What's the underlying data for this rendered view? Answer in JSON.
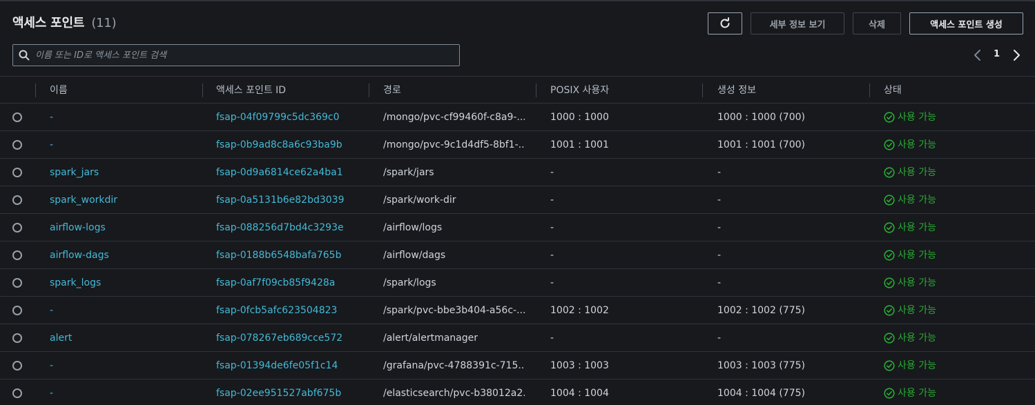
{
  "header": {
    "title": "액세스 포인트",
    "count": "(11)"
  },
  "toolbar": {
    "details_label": "세부 정보 보기",
    "delete_label": "삭제",
    "create_label": "액세스 포인트 생성"
  },
  "search": {
    "placeholder": "이름 또는 ID로 액세스 포인트 검색"
  },
  "pagination": {
    "current_page": "1"
  },
  "table": {
    "columns": [
      "이름",
      "액세스 포인트 ID",
      "경로",
      "POSIX 사용자",
      "생성 정보",
      "상태"
    ],
    "rows": [
      {
        "name": "-",
        "id": "fsap-04f09799c5dc369c0",
        "path": "/mongo/pvc-cf99460f-c8a9-...",
        "posix": "1000 : 1000",
        "create": "1000 : 1000 (700)",
        "status": "사용 가능"
      },
      {
        "name": "-",
        "id": "fsap-0b9ad8c8a6c93ba9b",
        "path": "/mongo/pvc-9c1d4df5-8bf1-...",
        "posix": "1001 : 1001",
        "create": "1001 : 1001 (700)",
        "status": "사용 가능"
      },
      {
        "name": "spark_jars",
        "id": "fsap-0d9a6814ce62a4ba1",
        "path": "/spark/jars",
        "posix": "-",
        "create": "-",
        "status": "사용 가능"
      },
      {
        "name": "spark_workdir",
        "id": "fsap-0a5131b6e82bd3039",
        "path": "/spark/work-dir",
        "posix": "-",
        "create": "-",
        "status": "사용 가능"
      },
      {
        "name": "airflow-logs",
        "id": "fsap-088256d7bd4c3293e",
        "path": "/airflow/logs",
        "posix": "-",
        "create": "-",
        "status": "사용 가능"
      },
      {
        "name": "airflow-dags",
        "id": "fsap-0188b6548bafa765b",
        "path": "/airflow/dags",
        "posix": "-",
        "create": "-",
        "status": "사용 가능"
      },
      {
        "name": "spark_logs",
        "id": "fsap-0af7f09cb85f9428a",
        "path": "/spark/logs",
        "posix": "-",
        "create": "-",
        "status": "사용 가능"
      },
      {
        "name": "-",
        "id": "fsap-0fcb5afc623504823",
        "path": "/spark/pvc-bbe3b404-a56c-...",
        "posix": "1002 : 1002",
        "create": "1002 : 1002 (775)",
        "status": "사용 가능"
      },
      {
        "name": "alert",
        "id": "fsap-078267eb689cce572",
        "path": "/alert/alertmanager",
        "posix": "-",
        "create": "-",
        "status": "사용 가능"
      },
      {
        "name": "-",
        "id": "fsap-01394de6fe05f1c14",
        "path": "/grafana/pvc-4788391c-715...",
        "posix": "1003 : 1003",
        "create": "1003 : 1003 (775)",
        "status": "사용 가능"
      },
      {
        "name": "-",
        "id": "fsap-02ee951527abf675b",
        "path": "/elasticsearch/pvc-b38012a2...",
        "posix": "1004 : 1004",
        "create": "1004 : 1004 (775)",
        "status": "사용 가능"
      }
    ]
  },
  "colors": {
    "link": "#44b9d6",
    "status_ok": "#29ad32",
    "background": "#17191d"
  },
  "icons": {
    "refresh": "refresh-icon",
    "search": "search-icon",
    "prev": "chevron-left-icon",
    "next": "chevron-right-icon",
    "status": "check-circle-icon"
  }
}
